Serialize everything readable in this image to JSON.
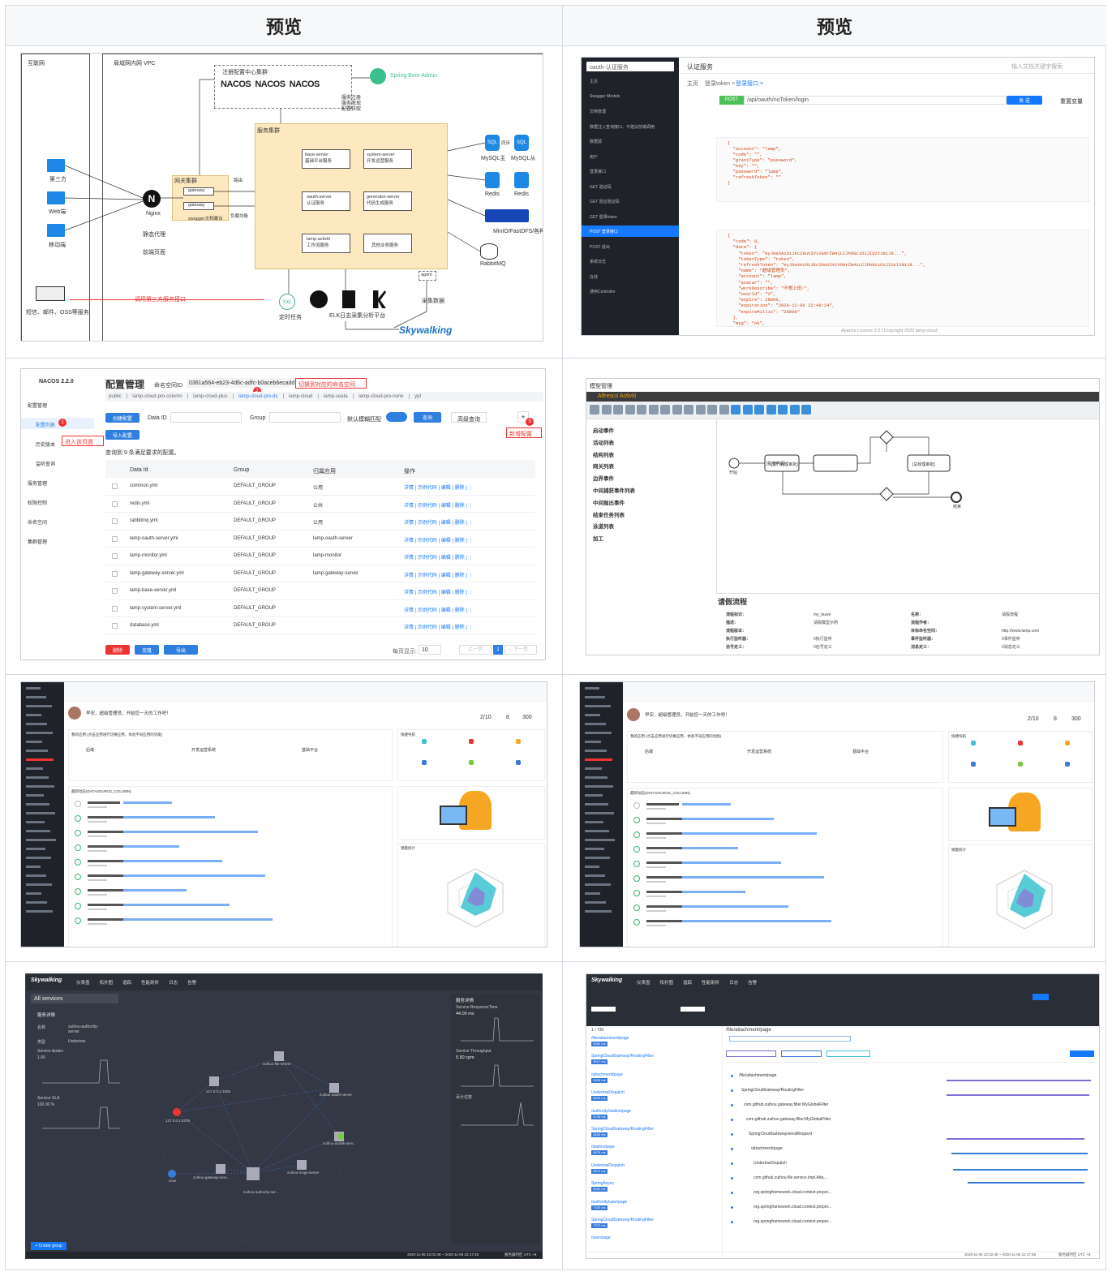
{
  "headers": {
    "left": "预览",
    "right": "预览"
  },
  "arch": {
    "internet": "互联网",
    "vpc": "局域网内网 VPC",
    "registry": "注册配置中心集群",
    "nacos": "NACOS",
    "sba": "Spring Boot Admin",
    "clients": [
      "第三方",
      "Web端",
      "移动端"
    ],
    "nginx": "Nginx",
    "static": "静态代理",
    "frontend": "前端页面",
    "gwcluster": "网关集群",
    "gateway": "gateway",
    "swagger": "swagger文档聚合",
    "svccluster": "服务集群",
    "services": [
      "base-server\n基础平台服务",
      "system-server\n开发运营服务",
      "oauth-server\n认证服务",
      "generator-server\n代码生成服务",
      "lamp-activiti\n工作流服务",
      "其他业务服务"
    ],
    "register_note": "服务注册\n服务发现\n配置获取",
    "route": "路由",
    "lb": "负载均衡",
    "mysql1": "MySQL主",
    "mysql2": "MySQL从",
    "sync": "同步",
    "redis1": "Redis",
    "redis2": "Redis",
    "oss": "MinIO/FastDFS/各种云OSS",
    "rabbit": "RabbitMQ",
    "xxl": "XXL",
    "timer": "定时任务",
    "elk": "ELK日志采集分析平台",
    "agent": "agent",
    "collect": "采集数据",
    "sky": "Skywalking",
    "sms": "短信、邮件、OSS等服务",
    "call": "调用第三方服务接口"
  },
  "swag": {
    "search": "oauth-认证服务",
    "title": "认证服务",
    "search2": "输入文档关键字搜索",
    "menu": [
      "主页",
      "Swagger Models",
      "文档管理",
      "数据注入查询接口、不建议前端调用",
      "数据源",
      "用户",
      "登录接口",
      "GET 验证码",
      "GET 验证验证码",
      "GET 登录token",
      "POST 登录接口",
      "POST 退出",
      "系统日志",
      "在线",
      "通用Controller"
    ],
    "tabs": [
      "主页",
      "登录token ×",
      "登录接口 ×"
    ],
    "method": "POST",
    "url": "/api/oauth/noToken/login",
    "send": "发 送",
    "reset": "重置变量",
    "footer": "Apache License 2.0 | Copyright 2020 lamp-cloud"
  },
  "nacos": {
    "brand": "NACOS 2.2.0",
    "title": "配置管理",
    "nsLabel": "命名空间ID",
    "nsId": "0361a564-eb23-4d6c-adfc-b0aceb6ecadd",
    "switchNote": "切换到对应的命名空间",
    "enterNote": "进入该页面",
    "newNote": "新增配置",
    "tabs": [
      "public",
      "lamp-cloud-pro-column",
      "lamp-cloud-plus",
      "lamp-cloud-pro-ds",
      "lamp-cloud",
      "lamp-seata",
      "lamp-cloud-pro-none",
      "ypt"
    ],
    "side": [
      "配置管理",
      "配置列表",
      "历史版本",
      "监听查询",
      "服务管理",
      "权限控制",
      "命名空间",
      "集群管理"
    ],
    "create": "创建配置",
    "import": "导入配置",
    "dataIdLbl": "Data ID",
    "groupLbl": "Group",
    "fuzzy": "默认模糊匹配",
    "query": "查询",
    "adv": "高级查询",
    "summary": "查询到 9 条满足要求的配置。",
    "cols": [
      "Data Id",
      "Group",
      "归属应用",
      "操作"
    ],
    "rows": [
      [
        "common.yml",
        "DEFAULT_GROUP",
        "公用"
      ],
      [
        "redis.yml",
        "DEFAULT_GROUP",
        "公共"
      ],
      [
        "rabbitmq.yml",
        "DEFAULT_GROUP",
        "公用"
      ],
      [
        "lamp-oauth-server.yml",
        "DEFAULT_GROUP",
        "lamp-oauth-server"
      ],
      [
        "lamp-monitor.yml",
        "DEFAULT_GROUP",
        "lamp-monitor"
      ],
      [
        "lamp-gateway-server.yml",
        "DEFAULT_GROUP",
        "lamp-gateway-server"
      ],
      [
        "lamp-base-server.yml",
        "DEFAULT_GROUP",
        ""
      ],
      [
        "lamp-system-server.yml",
        "DEFAULT_GROUP",
        ""
      ],
      [
        "database.yml",
        "DEFAULT_GROUP",
        ""
      ]
    ],
    "ops": "详情 | 示例代码 | 编辑 | 删除 | ⋮",
    "del": "删除",
    "clone": "克隆",
    "export": "导出",
    "pageSize": "每页显示:",
    "size": "10",
    "prev": "上一页",
    "next": "下一页",
    "page": "1"
  },
  "bpm": {
    "title": "模型管理",
    "brand": "Alfresco Activiti",
    "palette": [
      "启动事件",
      "活动列表",
      "结构列表",
      "网关列表",
      "边界事件",
      "中间捕获事件列表",
      "中间抛出事件",
      "结束任务列表",
      "泳道列表",
      "加工"
    ],
    "nodes": [
      "[提交申请]",
      "[部门经理审批]",
      "[总经理审批]"
    ],
    "start": "开始",
    "end": "结束",
    "prop": "请假流程",
    "fields": [
      [
        "流程标识：",
        "my_leave",
        "名称：",
        "请假流程"
      ],
      [
        "描述：",
        "请假模型示例",
        "流程作者：",
        ""
      ],
      [
        "流程版本：",
        "",
        "目标命名空间：",
        "http://www.lamp.com"
      ],
      [
        "执行监听器：",
        "0执行监听",
        "事件监听器：",
        "0事件监听"
      ],
      [
        "信号定义：",
        "0信号定义",
        "消息定义：",
        "0消息定义"
      ]
    ]
  },
  "dash": {
    "greet": "早安，超级管理员，开始您一天的工作吧！",
    "todo": "2/10",
    "msg": "8",
    "proj": "300",
    "projects": "我的应用 (点击应用进行切换应用，体验不同应用的功能)",
    "projNames": [
      "后端",
      "开发运营系统",
      "基础平台"
    ],
    "quick": "快捷导航",
    "news": "最新动态(DATASOURCE_COLUMN)",
    "radar": "销量统计",
    "more": "更多"
  },
  "sky": {
    "brand": "Skywalking",
    "tabs": [
      "仪表盘",
      "拓扑图",
      "追踪",
      "性能剖析",
      "日志",
      "告警"
    ],
    "allsvc": "All services",
    "svcDetail": "服务详情",
    "name": "zuihou-authority-server",
    "type": "Undertow",
    "apdex": "Service Apdex",
    "sla": "Service SLA",
    "sla_v": "100.00 %",
    "apdex_v": "1.00",
    "rt": "Service ResponseTime",
    "rt_v": "44.00 ms",
    "tp": "Service Throughput",
    "tp_v": "5.50 cpm",
    "pct": "百分位数",
    "nodes": [
      "zuihou-file-server",
      "127.0.0.1:3306",
      "zuihou-oauth-server",
      "zuihou-activiti-serv...",
      "zuihou-msgs-server",
      "zuihou-gateway-serv...",
      "User",
      "zuihou-authority-ser...",
      "127.0.0.1:6379"
    ],
    "create": "+ Create group",
    "time": "2020-11-05 22:02:48 ~ 2020-11-05 22:17:48",
    "tz": "服务器时区 UTC +8",
    "traceTitle": "/file/attachment/page",
    "traces": [
      "/file/attachment/page",
      "SpringCloudGateway/RoutingFilter",
      "/attachment/page",
      "UndertowDispatch",
      "/authority/station/page",
      "SpringCloudGateway/RoutingFilter",
      "/station/page",
      "UndertowDispatch",
      "SpringAsync",
      "/authority/user/page",
      "SpringCloudGateway/RoutingFilter",
      "/user/page"
    ],
    "durs": [
      "5000 ms",
      "5017 ms",
      "5005 ms",
      "6609 ms",
      "6736 ms",
      "6654 ms",
      "6676 ms",
      "6674 ms",
      "6094 ms",
      "7420 ms",
      "7372 ms",
      ""
    ],
    "spans": [
      "/file/attachment/page",
      "SpringCloudGateway/RoutingFilter",
      "com.github.zuihou.gateway.filter.MyGlobalFilter",
      "com.github.zuihou.gateway.filter.MyGlobalFilter",
      "SpringCloudGateway/sendRequest",
      "/attachment/page",
      "UndertowDispatch",
      "com.github.zuihou.file.service.impl.Atta...",
      "org.springframework.cloud.context.proper...",
      "org.springframework.cloud.context.proper...",
      "org.springframework.cloud.context.proper..."
    ],
    "pageCount": "1 / 730"
  },
  "colors": {
    "blue": "#1677ff",
    "orange": "#f5a623",
    "nacosBlue": "#2f7fe0",
    "skyBg": "#2b2f38",
    "dark": "#222730"
  }
}
